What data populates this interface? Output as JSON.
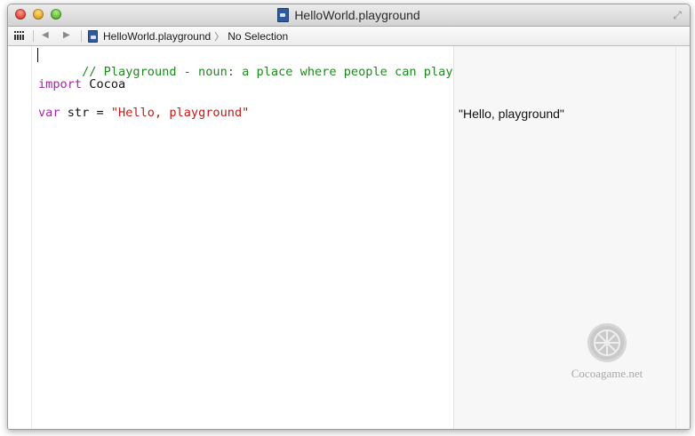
{
  "window": {
    "title": "HelloWorld.playground"
  },
  "jumpbar": {
    "file": "HelloWorld.playground",
    "selection": "No Selection",
    "back_icon": "◀",
    "forward_icon": "▶",
    "chevron": "〉"
  },
  "code": {
    "line1_comment": "// Playground - noun: a place where people can play",
    "line2_keyword": "import",
    "line2_module": " Cocoa",
    "line3_keyword": "var",
    "line3_rest": " str = ",
    "line3_string": "\"Hello, playground\""
  },
  "results": {
    "line3_result": "\"Hello, playground\""
  },
  "watermark": {
    "text": "Cocoagame.net"
  },
  "colors": {
    "comment": "#1d8a1d",
    "keyword": "#a826a8",
    "string": "#c41a16"
  }
}
